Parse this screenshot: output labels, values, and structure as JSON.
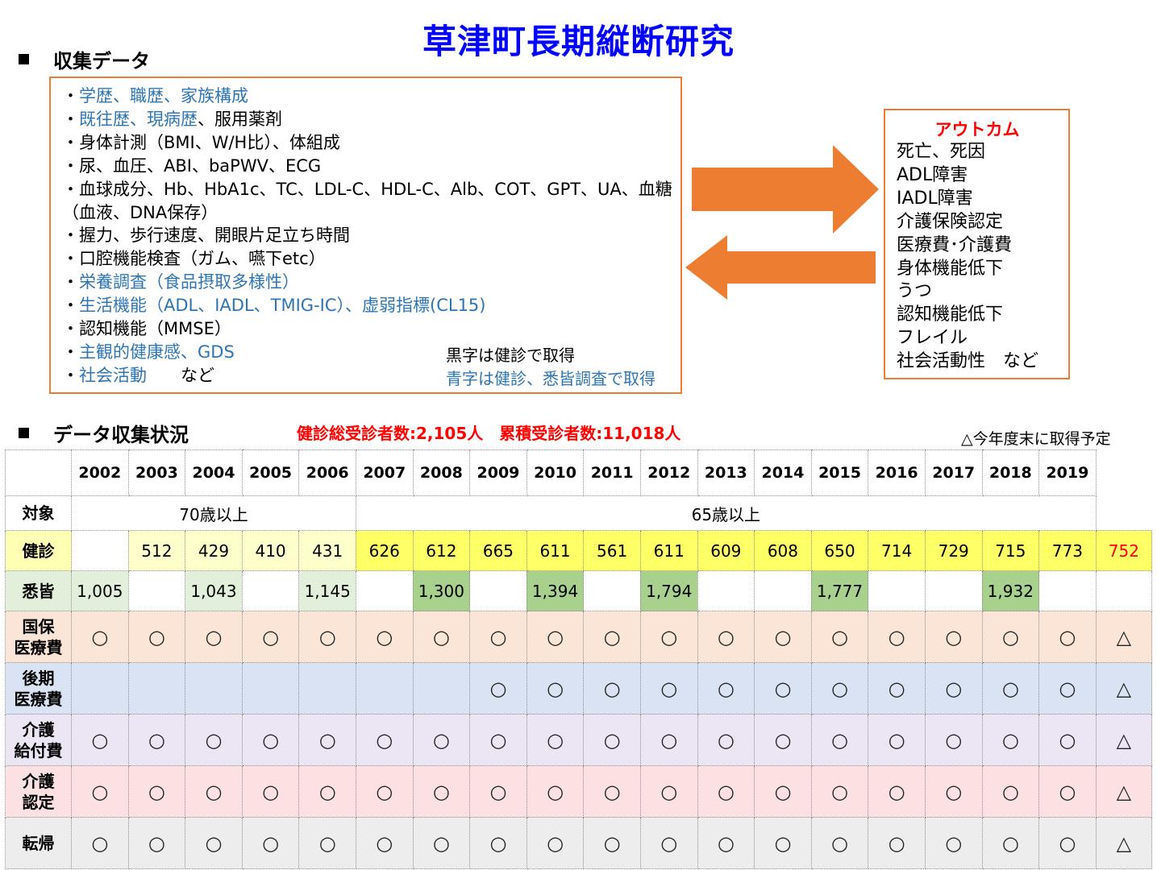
{
  "title": "草津町長期縦断研究",
  "collection": {
    "heading": "収集データ",
    "items": [
      {
        "parts": [
          {
            "t": "・",
            "c": "black"
          },
          {
            "t": "学歴、職歴、家族構成",
            "c": "blue"
          }
        ]
      },
      {
        "parts": [
          {
            "t": "・",
            "c": "black"
          },
          {
            "t": "既往歴、現病歴",
            "c": "blue"
          },
          {
            "t": "、服用薬剤",
            "c": "black"
          }
        ]
      },
      {
        "parts": [
          {
            "t": "・身体計測（BMI、W/H比）、体組成",
            "c": "black"
          }
        ]
      },
      {
        "parts": [
          {
            "t": "・尿、血圧、ABI、baPWV、ECG",
            "c": "black"
          }
        ]
      },
      {
        "parts": [
          {
            "t": "・血球成分、Hb、HbA1c、TC、LDL-C、HDL-C、Alb、COT、GPT、UA、血糖",
            "c": "black"
          }
        ]
      },
      {
        "parts": [
          {
            "t": "（血液、DNA保存）",
            "c": "black"
          }
        ]
      },
      {
        "parts": [
          {
            "t": "・握力、歩行速度、開眼片足立ち時間",
            "c": "black"
          }
        ]
      },
      {
        "parts": [
          {
            "t": "・口腔機能検査（ガム、嚥下etc）",
            "c": "black"
          }
        ]
      },
      {
        "parts": [
          {
            "t": "・",
            "c": "black"
          },
          {
            "t": "栄養調査（食品摂取多様性）",
            "c": "blue"
          }
        ]
      },
      {
        "parts": [
          {
            "t": "・",
            "c": "black"
          },
          {
            "t": "生活機能（ADL、IADL、TMIG-IC）、虚弱指標(CL15)",
            "c": "blue"
          }
        ]
      },
      {
        "parts": [
          {
            "t": "・認知機能（MMSE）",
            "c": "black"
          }
        ]
      },
      {
        "parts": [
          {
            "t": "・",
            "c": "black"
          },
          {
            "t": "主観的健康感、GDS",
            "c": "blue"
          }
        ]
      },
      {
        "parts": [
          {
            "t": "・",
            "c": "black"
          },
          {
            "t": "社会活動",
            "c": "blue"
          },
          {
            "t": "　　など",
            "c": "black"
          }
        ]
      }
    ],
    "legend_black": "黒字は健診で取得",
    "legend_blue": "青字は健診、悉皆調査で取得"
  },
  "outcome": {
    "title": "アウトカム",
    "items": [
      "死亡、死因",
      "ADL障害",
      "IADL障害",
      "介護保険認定",
      "医療費･介護費",
      "身体機能低下",
      "うつ",
      "認知機能低下",
      "フレイル",
      "社会活動性　など"
    ]
  },
  "status": {
    "heading": "データ収集状況",
    "totals": "健診総受診者数:2,105人　累積受診者数:11,018人",
    "note": "△今年度末に取得予定",
    "years": [
      "",
      "2002",
      "2003",
      "2004",
      "2005",
      "2006",
      "2007",
      "2008",
      "2009",
      "2010",
      "2011",
      "2012",
      "2013",
      "2014",
      "2015",
      "2016",
      "2017",
      "2018",
      "2019"
    ],
    "target": {
      "label": "対象",
      "group1": "70歳以上",
      "group2": "65歳以上"
    },
    "checkup": {
      "label": "健診",
      "values": [
        "",
        "512",
        "429",
        "410",
        "431",
        "626",
        "612",
        "665",
        "611",
        "561",
        "611",
        "609",
        "608",
        "650",
        "714",
        "729",
        "715",
        "773",
        "752"
      ]
    },
    "survey": {
      "label": "悉皆",
      "values": [
        "1,005",
        "",
        "1,043",
        "",
        "1,145",
        "",
        "1,300",
        "",
        "1,394",
        "",
        "1,794",
        "",
        "",
        "1,777",
        "",
        "",
        "1,932",
        "",
        ""
      ]
    },
    "rows": [
      {
        "label1": "国保",
        "label2": "医療費",
        "color": "#fbe5d6",
        "marks": [
          "○",
          "○",
          "○",
          "○",
          "○",
          "○",
          "○",
          "○",
          "○",
          "○",
          "○",
          "○",
          "○",
          "○",
          "○",
          "○",
          "○",
          "○",
          "△"
        ]
      },
      {
        "label1": "後期",
        "label2": "医療費",
        "color": "#dae3f3",
        "marks": [
          "",
          "",
          "",
          "",
          "",
          "",
          "",
          "○",
          "○",
          "○",
          "○",
          "○",
          "○",
          "○",
          "○",
          "○",
          "○",
          "○",
          "△"
        ]
      },
      {
        "label1": "介護",
        "label2": "給付費",
        "color": "#ece5f4",
        "marks": [
          "○",
          "○",
          "○",
          "○",
          "○",
          "○",
          "○",
          "○",
          "○",
          "○",
          "○",
          "○",
          "○",
          "○",
          "○",
          "○",
          "○",
          "○",
          "△"
        ]
      },
      {
        "label1": "介護",
        "label2": "認定",
        "color": "#fce0e2",
        "marks": [
          "○",
          "○",
          "○",
          "○",
          "○",
          "○",
          "○",
          "○",
          "○",
          "○",
          "○",
          "○",
          "○",
          "○",
          "○",
          "○",
          "○",
          "○",
          "△"
        ]
      },
      {
        "label1": "転帰",
        "label2": "",
        "color": "#ededed",
        "marks": [
          "○",
          "○",
          "○",
          "○",
          "○",
          "○",
          "○",
          "○",
          "○",
          "○",
          "○",
          "○",
          "○",
          "○",
          "○",
          "○",
          "○",
          "○",
          "△"
        ]
      }
    ]
  }
}
